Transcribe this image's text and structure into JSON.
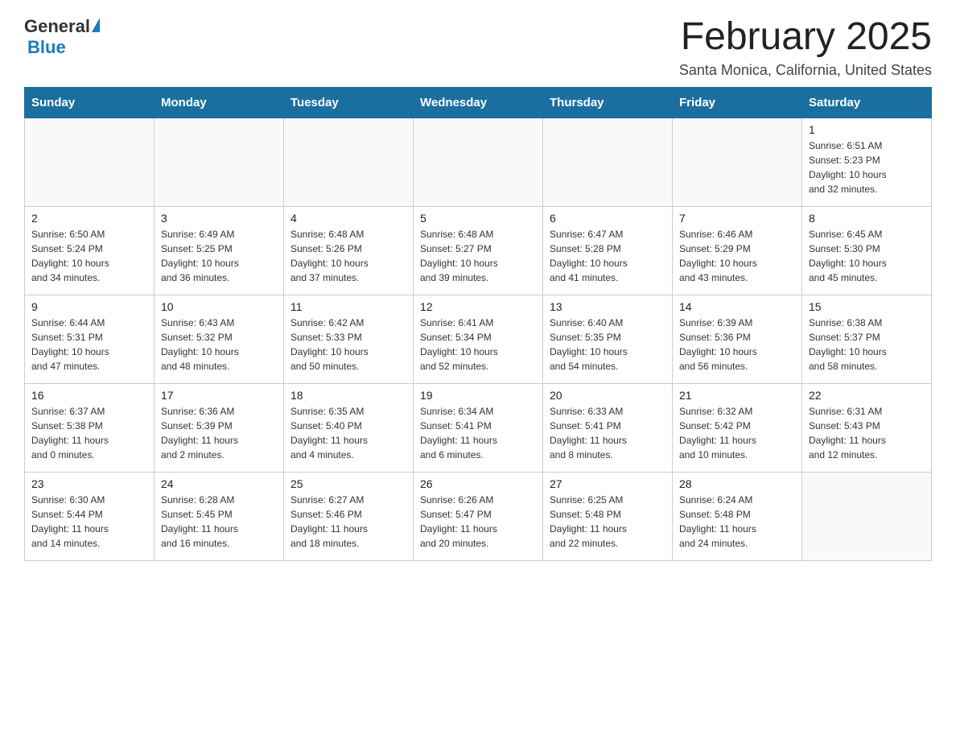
{
  "header": {
    "logo_general": "General",
    "logo_blue": "Blue",
    "month_title": "February 2025",
    "location": "Santa Monica, California, United States"
  },
  "days_of_week": [
    "Sunday",
    "Monday",
    "Tuesday",
    "Wednesday",
    "Thursday",
    "Friday",
    "Saturday"
  ],
  "weeks": [
    [
      {
        "day": "",
        "info": ""
      },
      {
        "day": "",
        "info": ""
      },
      {
        "day": "",
        "info": ""
      },
      {
        "day": "",
        "info": ""
      },
      {
        "day": "",
        "info": ""
      },
      {
        "day": "",
        "info": ""
      },
      {
        "day": "1",
        "info": "Sunrise: 6:51 AM\nSunset: 5:23 PM\nDaylight: 10 hours\nand 32 minutes."
      }
    ],
    [
      {
        "day": "2",
        "info": "Sunrise: 6:50 AM\nSunset: 5:24 PM\nDaylight: 10 hours\nand 34 minutes."
      },
      {
        "day": "3",
        "info": "Sunrise: 6:49 AM\nSunset: 5:25 PM\nDaylight: 10 hours\nand 36 minutes."
      },
      {
        "day": "4",
        "info": "Sunrise: 6:48 AM\nSunset: 5:26 PM\nDaylight: 10 hours\nand 37 minutes."
      },
      {
        "day": "5",
        "info": "Sunrise: 6:48 AM\nSunset: 5:27 PM\nDaylight: 10 hours\nand 39 minutes."
      },
      {
        "day": "6",
        "info": "Sunrise: 6:47 AM\nSunset: 5:28 PM\nDaylight: 10 hours\nand 41 minutes."
      },
      {
        "day": "7",
        "info": "Sunrise: 6:46 AM\nSunset: 5:29 PM\nDaylight: 10 hours\nand 43 minutes."
      },
      {
        "day": "8",
        "info": "Sunrise: 6:45 AM\nSunset: 5:30 PM\nDaylight: 10 hours\nand 45 minutes."
      }
    ],
    [
      {
        "day": "9",
        "info": "Sunrise: 6:44 AM\nSunset: 5:31 PM\nDaylight: 10 hours\nand 47 minutes."
      },
      {
        "day": "10",
        "info": "Sunrise: 6:43 AM\nSunset: 5:32 PM\nDaylight: 10 hours\nand 48 minutes."
      },
      {
        "day": "11",
        "info": "Sunrise: 6:42 AM\nSunset: 5:33 PM\nDaylight: 10 hours\nand 50 minutes."
      },
      {
        "day": "12",
        "info": "Sunrise: 6:41 AM\nSunset: 5:34 PM\nDaylight: 10 hours\nand 52 minutes."
      },
      {
        "day": "13",
        "info": "Sunrise: 6:40 AM\nSunset: 5:35 PM\nDaylight: 10 hours\nand 54 minutes."
      },
      {
        "day": "14",
        "info": "Sunrise: 6:39 AM\nSunset: 5:36 PM\nDaylight: 10 hours\nand 56 minutes."
      },
      {
        "day": "15",
        "info": "Sunrise: 6:38 AM\nSunset: 5:37 PM\nDaylight: 10 hours\nand 58 minutes."
      }
    ],
    [
      {
        "day": "16",
        "info": "Sunrise: 6:37 AM\nSunset: 5:38 PM\nDaylight: 11 hours\nand 0 minutes."
      },
      {
        "day": "17",
        "info": "Sunrise: 6:36 AM\nSunset: 5:39 PM\nDaylight: 11 hours\nand 2 minutes."
      },
      {
        "day": "18",
        "info": "Sunrise: 6:35 AM\nSunset: 5:40 PM\nDaylight: 11 hours\nand 4 minutes."
      },
      {
        "day": "19",
        "info": "Sunrise: 6:34 AM\nSunset: 5:41 PM\nDaylight: 11 hours\nand 6 minutes."
      },
      {
        "day": "20",
        "info": "Sunrise: 6:33 AM\nSunset: 5:41 PM\nDaylight: 11 hours\nand 8 minutes."
      },
      {
        "day": "21",
        "info": "Sunrise: 6:32 AM\nSunset: 5:42 PM\nDaylight: 11 hours\nand 10 minutes."
      },
      {
        "day": "22",
        "info": "Sunrise: 6:31 AM\nSunset: 5:43 PM\nDaylight: 11 hours\nand 12 minutes."
      }
    ],
    [
      {
        "day": "23",
        "info": "Sunrise: 6:30 AM\nSunset: 5:44 PM\nDaylight: 11 hours\nand 14 minutes."
      },
      {
        "day": "24",
        "info": "Sunrise: 6:28 AM\nSunset: 5:45 PM\nDaylight: 11 hours\nand 16 minutes."
      },
      {
        "day": "25",
        "info": "Sunrise: 6:27 AM\nSunset: 5:46 PM\nDaylight: 11 hours\nand 18 minutes."
      },
      {
        "day": "26",
        "info": "Sunrise: 6:26 AM\nSunset: 5:47 PM\nDaylight: 11 hours\nand 20 minutes."
      },
      {
        "day": "27",
        "info": "Sunrise: 6:25 AM\nSunset: 5:48 PM\nDaylight: 11 hours\nand 22 minutes."
      },
      {
        "day": "28",
        "info": "Sunrise: 6:24 AM\nSunset: 5:48 PM\nDaylight: 11 hours\nand 24 minutes."
      },
      {
        "day": "",
        "info": ""
      }
    ]
  ]
}
